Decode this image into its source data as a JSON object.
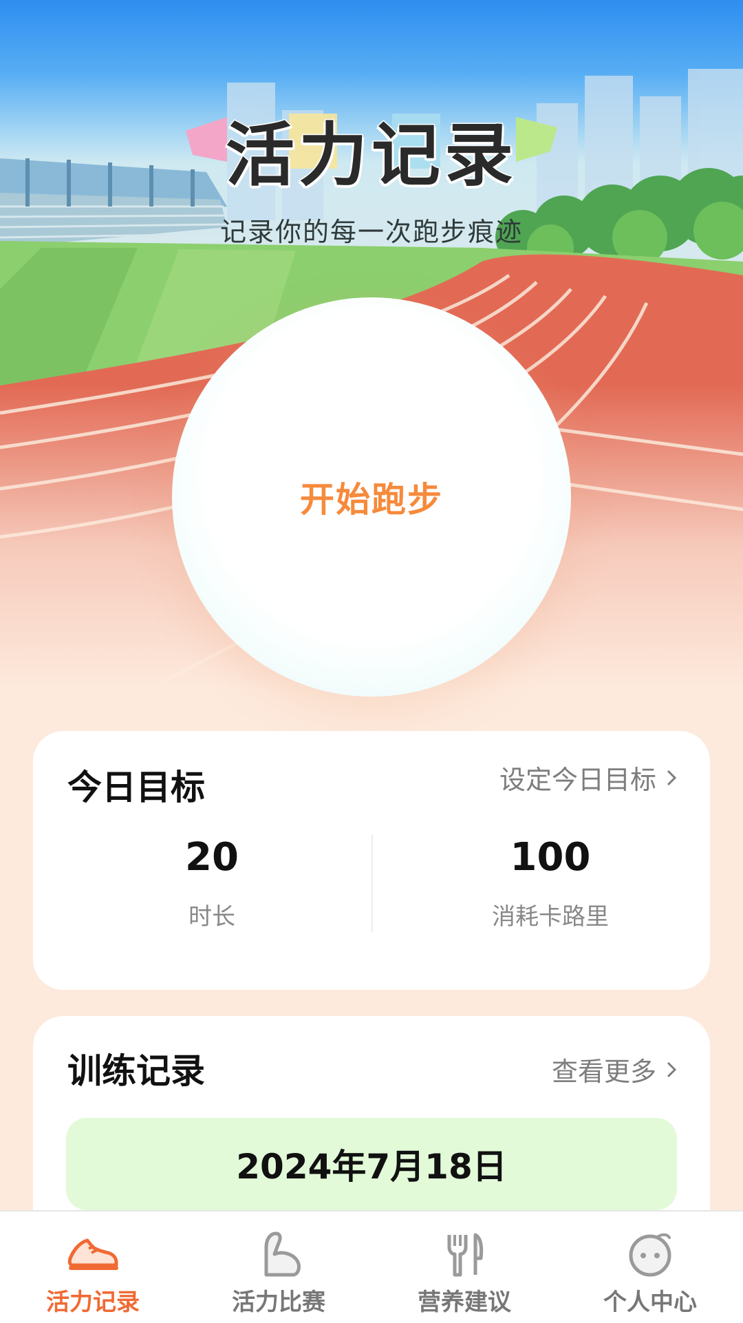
{
  "header": {
    "title": "活力记录",
    "subtitle": "记录你的每一次跑步痕迹"
  },
  "start_button": {
    "label": "开始跑步"
  },
  "goal_card": {
    "title": "今日目标",
    "link_label": "设定今日目标",
    "stats": [
      {
        "value": "20",
        "label": "时长"
      },
      {
        "value": "100",
        "label": "消耗卡路里"
      }
    ]
  },
  "records_card": {
    "title": "训练记录",
    "link_label": "查看更多",
    "date": "2024年7月18日"
  },
  "tabbar": {
    "active_index": 0,
    "tabs": [
      {
        "label": "活力记录",
        "icon": "running-shoe-icon"
      },
      {
        "label": "活力比赛",
        "icon": "flexed-arm-icon"
      },
      {
        "label": "营养建议",
        "icon": "fork-knife-icon"
      },
      {
        "label": "个人中心",
        "icon": "face-icon"
      }
    ]
  },
  "colors": {
    "accent": "#f68a3c",
    "active_tab": "#f06a34",
    "date_pill": "#e2fad8",
    "background": "#fdeadd"
  }
}
